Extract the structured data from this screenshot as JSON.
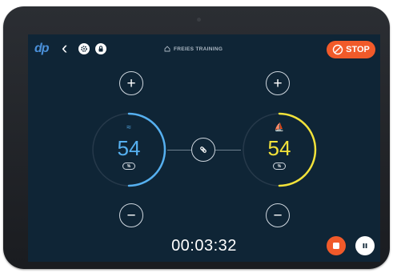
{
  "header": {
    "logo_text": "dp",
    "title": "FREIES TRAINING",
    "stop_label": "STOP"
  },
  "left_dial": {
    "value": "54",
    "color": "#56b0f0",
    "symbol": "≈",
    "badge": "%",
    "level": 0.5
  },
  "right_dial": {
    "value": "54",
    "color": "#f2e23a",
    "symbol": "⛵",
    "badge": "%",
    "level": 0.5
  },
  "controls": {
    "plus": "+",
    "minus": "−"
  },
  "timer": "00:03:32",
  "icons": [
    "back-icon",
    "settings-icon",
    "lock-icon",
    "home-icon",
    "no-entry-icon",
    "link-icon",
    "record-icon",
    "pause-icon"
  ],
  "colors": {
    "background": "#0f2536",
    "accent": "#f15a2a"
  }
}
